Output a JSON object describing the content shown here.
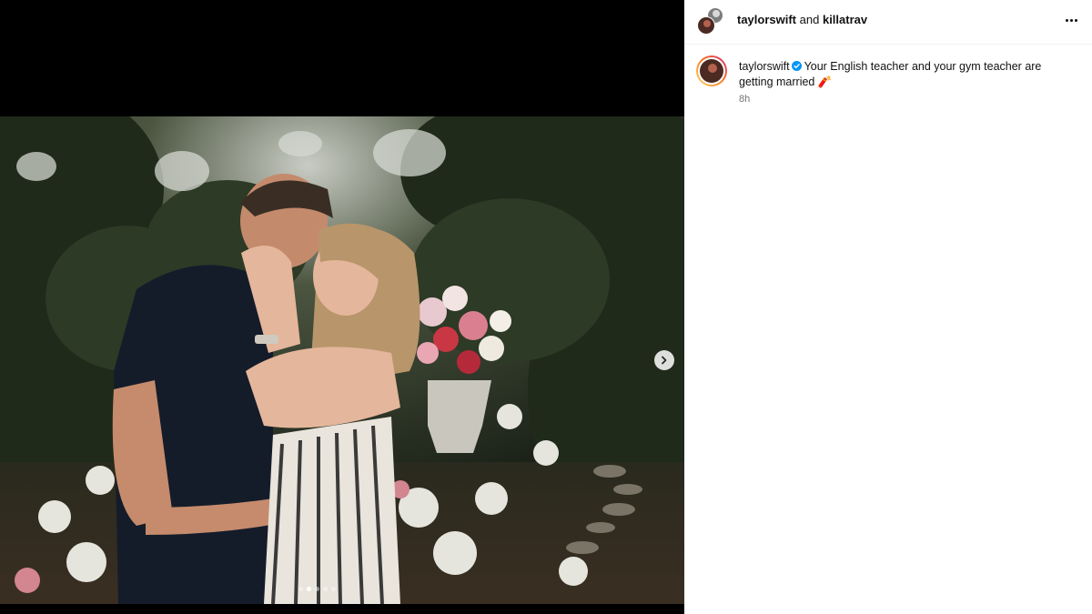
{
  "header": {
    "user1": "taylorswift",
    "joiner": "and",
    "user2": "killatrav"
  },
  "caption": {
    "username": "taylorswift",
    "text": "Your English teacher and your gym teacher are getting married",
    "emoji": "🧨",
    "time": "8h"
  },
  "carousel": {
    "total_slides": 5,
    "active_slide": 2
  },
  "icons": {
    "more": "more-options-icon",
    "next": "chevron-right-icon",
    "verified": "verified-badge-icon"
  },
  "colors": {
    "verified": "#0095f6",
    "story_ring_start": "#feda75",
    "story_ring_end": "#d62976"
  }
}
